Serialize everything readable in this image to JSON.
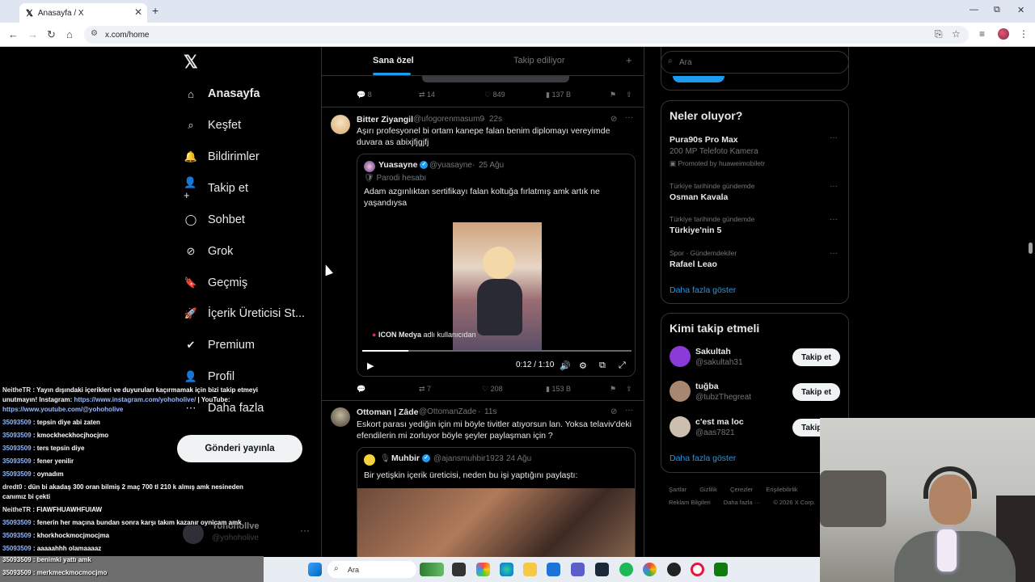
{
  "browser": {
    "tab_title": "Anasayfa / X",
    "url": "x.com/home"
  },
  "nav": {
    "items": [
      {
        "label": "Anasayfa",
        "icon": "home-icon"
      },
      {
        "label": "Keşfet",
        "icon": "search-icon"
      },
      {
        "label": "Bildirimler",
        "icon": "bell-icon"
      },
      {
        "label": "Takip et",
        "icon": "add-person-icon"
      },
      {
        "label": "Sohbet",
        "icon": "chat-icon"
      },
      {
        "label": "Grok",
        "icon": "grok-icon"
      },
      {
        "label": "Geçmiş",
        "icon": "bookmark-icon"
      },
      {
        "label": "İçerik Üreticisi St...",
        "icon": "rocket-icon"
      },
      {
        "label": "Premium",
        "icon": "verified-icon"
      },
      {
        "label": "Profil",
        "icon": "person-icon"
      },
      {
        "label": "Daha fazla",
        "icon": "more-circle-icon"
      }
    ],
    "post_button": "Gönderi yayınla",
    "account_name": "Yohohollve",
    "account_handle": "@yohoholive"
  },
  "timeline": {
    "tabs": [
      "Sana özel",
      "Takip ediliyor"
    ],
    "prev_actions": {
      "replies": "8",
      "reposts": "14",
      "likes": "849",
      "views": "137 B"
    },
    "tweet1": {
      "name": "Bitter Ziyangil",
      "handle": "@ufogorenmasum9",
      "time": "22s",
      "text": "Aşırı profesyonel bi ortam kanepe falan benim diplomayı vereyimde duvara as abixjfjgjfj",
      "quote": {
        "name": "Yuasayne",
        "handle": "@yuasayne",
        "date": "25 Ağu",
        "label": "Parodi hesabı",
        "text": "Adam azgınlıktan sertifikayı falan koltuğa fırlatmış amk artık ne yaşandıysa",
        "video_attrib_name": "ICON Medya",
        "video_attrib_rest": "adlı kullanıcıdan",
        "video_time": "0:12 / 1:10",
        "progress": 0.17
      },
      "actions": {
        "replies": "",
        "reposts": "7",
        "likes": "208",
        "views": "153 B"
      }
    },
    "tweet2": {
      "name": "Ottoman | Zâde",
      "handle": "@OttomanZade",
      "time": "11s",
      "text": "Eskort parası yediğin için mi böyle tivitler atıyorsun lan. Yoksa telaviv'deki efendilerin mi zorluyor böyle şeyler paylaşman için ?",
      "quote": {
        "name": "Muhbir",
        "handle": "@ajansmuhbir1923",
        "date": "24 Ağu",
        "text": "Bir yetişkin içerik üreticisi, neden bu işi yaptığını paylaştı:"
      }
    }
  },
  "right": {
    "search_placeholder": "Ara",
    "trends_title": "Neler oluyor?",
    "trends": [
      {
        "small": "",
        "big": "Pura90s Pro Max",
        "sub": "200 MP Telefoto Kamera",
        "promo": "Promoted by huaweimobiletr"
      },
      {
        "small": "Türkiye tarihinde gündemde",
        "big": "Osman Kavala"
      },
      {
        "small": "Türkiye tarihinde gündemde",
        "big": "Türkiye'nin 5"
      },
      {
        "small": "Spor · Gündemdekiler",
        "big": "Rafael Leao"
      }
    ],
    "show_more": "Daha fazla göster",
    "follow_title": "Kimi takip etmeli",
    "follow": [
      {
        "name": "Sakultah",
        "handle": "@sakultah31",
        "button": "Takip et",
        "color": "#8a3ad6"
      },
      {
        "name": "tuğba",
        "handle": "@tubzThegreat",
        "button": "Takip et",
        "color": "#a88770"
      },
      {
        "name": "c'est ma loc",
        "handle": "@aas7821",
        "button": "Takip et",
        "color": "#cdbfb0"
      }
    ],
    "footer": [
      "Şartlar",
      "Gizlilik",
      "Çerezler",
      "Erişilebilirlik",
      "Reklam Bilgileri",
      "Daha fazla ···",
      "© 2026 X Corp."
    ]
  },
  "chat": {
    "lines": [
      {
        "user": "NeitheTR",
        "text": " : Yayın dışındaki içerikleri ve duyuruları kaçırmamak için bizi takip etmeyi unutmayın! Instagram: ",
        "link": "https://www.instagram.com/yohoholive/",
        "text2": " | YouTube: ",
        "link2": "https://www.youtube.com/@yohoholive"
      },
      {
        "user": "35093509",
        "text": " : tepsin diye abi zaten"
      },
      {
        "user": "35093509",
        "text": " : kmockheckhocjhocjmo"
      },
      {
        "user": "35093509",
        "text": " : ters tepsin diye"
      },
      {
        "user": "35093509",
        "text": " : fener yenilir"
      },
      {
        "user": "35093509",
        "text": " : oynadım"
      },
      {
        "user": "dredt0",
        "text": " : dün bi akadaş 300 oran bilmiş 2 maç 700 tl 210 k almış amk nesineden canımız bi çekti"
      },
      {
        "user": "NeitheTR",
        "text": " : FIAWFHUAWHFUIAW"
      },
      {
        "user": "35093509",
        "text": " : fenerin her maçına bundan sonra karşı takım kazanır oynicam amk"
      },
      {
        "user": "35093509",
        "text": " : khorkhockmocjmocjma"
      },
      {
        "user": "35093509",
        "text": " : aaaaahhh olamaaaaz"
      },
      {
        "user": "35093509",
        "text": " : benimki yattı amk"
      },
      {
        "user": "35093509",
        "text": " : merkmeckmocmocjmo"
      }
    ]
  },
  "taskbar": {
    "search": "Ara"
  }
}
